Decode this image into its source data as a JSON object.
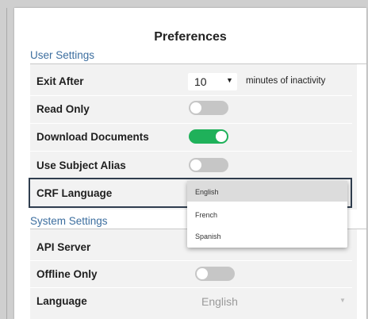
{
  "dialog": {
    "title": "Preferences"
  },
  "user_settings": {
    "section_label": "User Settings",
    "exit_after": {
      "label": "Exit After",
      "value": "10",
      "suffix": "minutes of inactivity"
    },
    "read_only": {
      "label": "Read Only",
      "enabled": false
    },
    "download_documents": {
      "label": "Download Documents",
      "enabled": true
    },
    "use_subject_alias": {
      "label": "Use Subject Alias",
      "enabled": false
    },
    "crf_language": {
      "label": "CRF Language",
      "options": [
        "English",
        "French",
        "Spanish"
      ],
      "selected": "English"
    }
  },
  "system_settings": {
    "section_label": "System Settings",
    "api_server": {
      "label": "API Server"
    },
    "offline_only": {
      "label": "Offline Only",
      "enabled": false
    },
    "language": {
      "label": "Language",
      "value": "English"
    }
  },
  "colors": {
    "section_heading": "#3c6e9f",
    "toggle_on": "#1fb15a",
    "toggle_off": "#c6c6c6",
    "focus_border": "#2f3d4e"
  },
  "icons": {
    "select_caret": "caret-down-icon"
  }
}
